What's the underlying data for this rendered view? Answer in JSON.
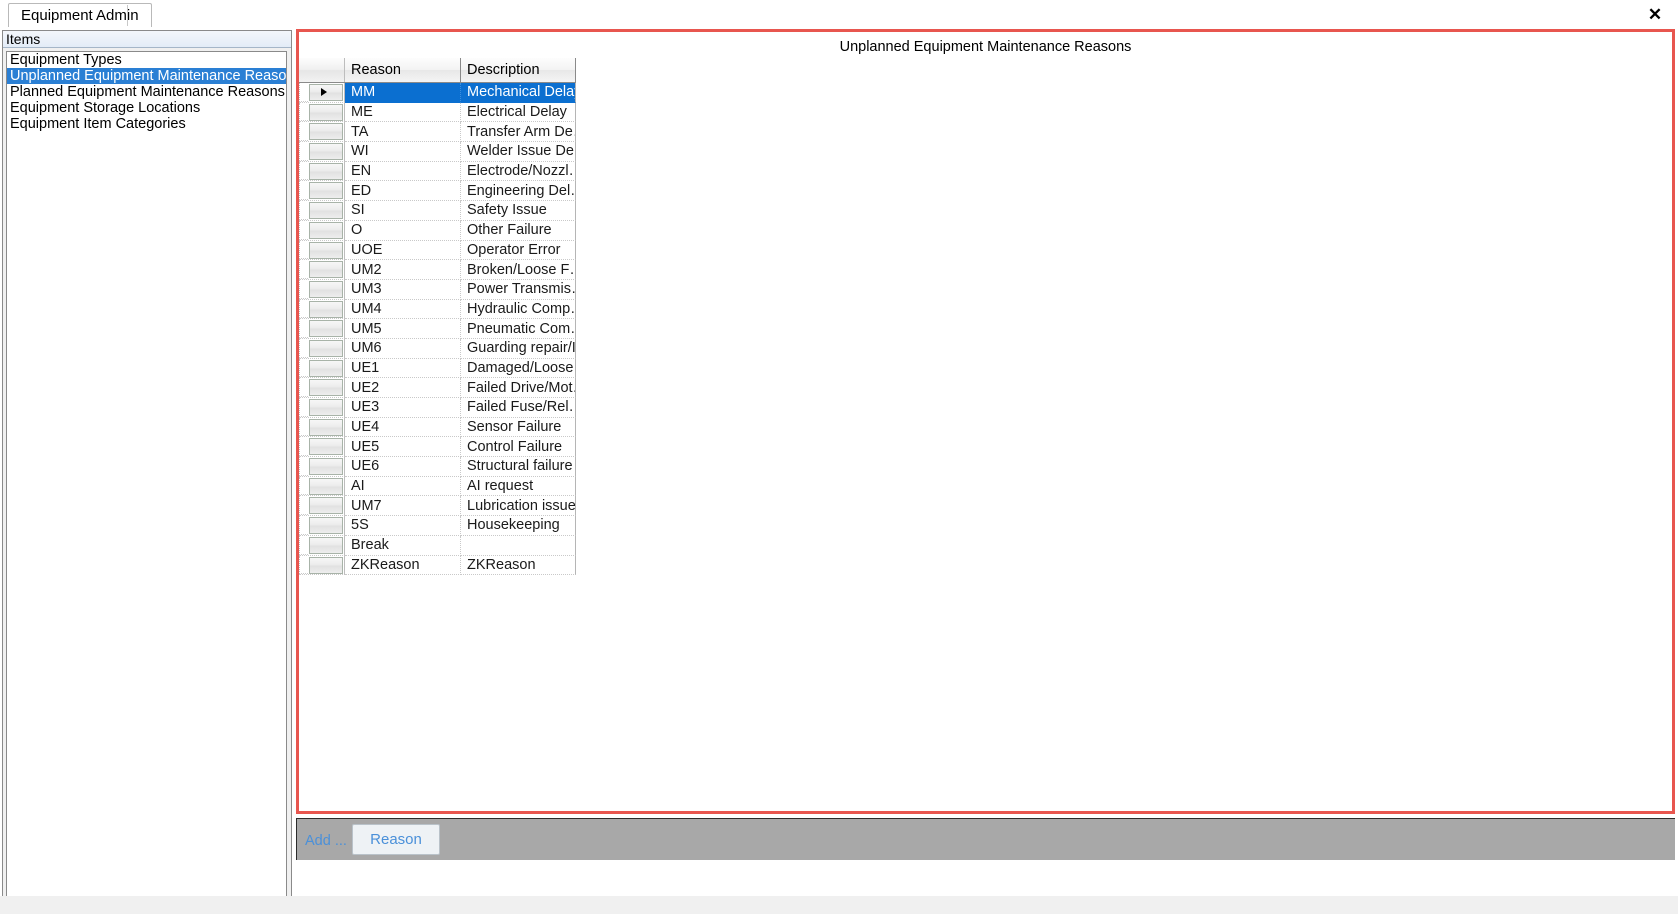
{
  "window": {
    "tab_label": "Equipment Admin",
    "close_icon": "close-icon",
    "close_glyph": "✕"
  },
  "sidebar": {
    "header_label": "Items",
    "items": [
      {
        "label": "Equipment Types",
        "selected": false
      },
      {
        "label": "Unplanned Equipment Maintenance Reasons",
        "selected": true
      },
      {
        "label": "Planned Equipment Maintenance Reasons",
        "selected": false
      },
      {
        "label": "Equipment Storage Locations",
        "selected": false
      },
      {
        "label": "Equipment Item Categories",
        "selected": false
      }
    ]
  },
  "content": {
    "title": "Unplanned Equipment Maintenance Reasons",
    "border_color": "#e8564f",
    "selection_color": "#0b6fd0",
    "grid": {
      "columns": [
        "Reason",
        "Description"
      ],
      "rows": [
        {
          "reason": "MM",
          "description": "Mechanical Delay",
          "selected": true
        },
        {
          "reason": "ME",
          "description": "Electrical Delay",
          "selected": false
        },
        {
          "reason": "TA",
          "description": "Transfer Arm De…",
          "selected": false
        },
        {
          "reason": "WI",
          "description": "Welder Issue De…",
          "selected": false
        },
        {
          "reason": "EN",
          "description": "Electrode/Nozzl…",
          "selected": false
        },
        {
          "reason": "ED",
          "description": "Engineering Del…",
          "selected": false
        },
        {
          "reason": "SI",
          "description": "Safety Issue",
          "selected": false
        },
        {
          "reason": "O",
          "description": "Other Failure",
          "selected": false
        },
        {
          "reason": "UOE",
          "description": "Operator Error",
          "selected": false
        },
        {
          "reason": "UM2",
          "description": "Broken/Loose F…",
          "selected": false
        },
        {
          "reason": "UM3",
          "description": "Power Transmis…",
          "selected": false
        },
        {
          "reason": "UM4",
          "description": "Hydraulic Comp…",
          "selected": false
        },
        {
          "reason": "UM5",
          "description": "Pneumatic  Com…",
          "selected": false
        },
        {
          "reason": "UM6",
          "description": "Guarding repair/I…",
          "selected": false
        },
        {
          "reason": "UE1",
          "description": "Damaged/Loose…",
          "selected": false
        },
        {
          "reason": "UE2",
          "description": "Failed Drive/Mot…",
          "selected": false
        },
        {
          "reason": "UE3",
          "description": "Failed Fuse/Rel…",
          "selected": false
        },
        {
          "reason": "UE4",
          "description": "Sensor Failure",
          "selected": false
        },
        {
          "reason": "UE5",
          "description": "Control Failure",
          "selected": false
        },
        {
          "reason": "UE6",
          "description": "Structural failure",
          "selected": false
        },
        {
          "reason": "AI",
          "description": "AI request",
          "selected": false
        },
        {
          "reason": "UM7",
          "description": "Lubrication issue",
          "selected": false
        },
        {
          "reason": "5S",
          "description": "Housekeeping",
          "selected": false
        },
        {
          "reason": "Break",
          "description": "",
          "selected": false
        },
        {
          "reason": "ZKReason",
          "description": "ZKReason",
          "selected": false
        }
      ]
    }
  },
  "toolbar": {
    "add_label": "Add ...",
    "reason_button_label": "Reason"
  }
}
